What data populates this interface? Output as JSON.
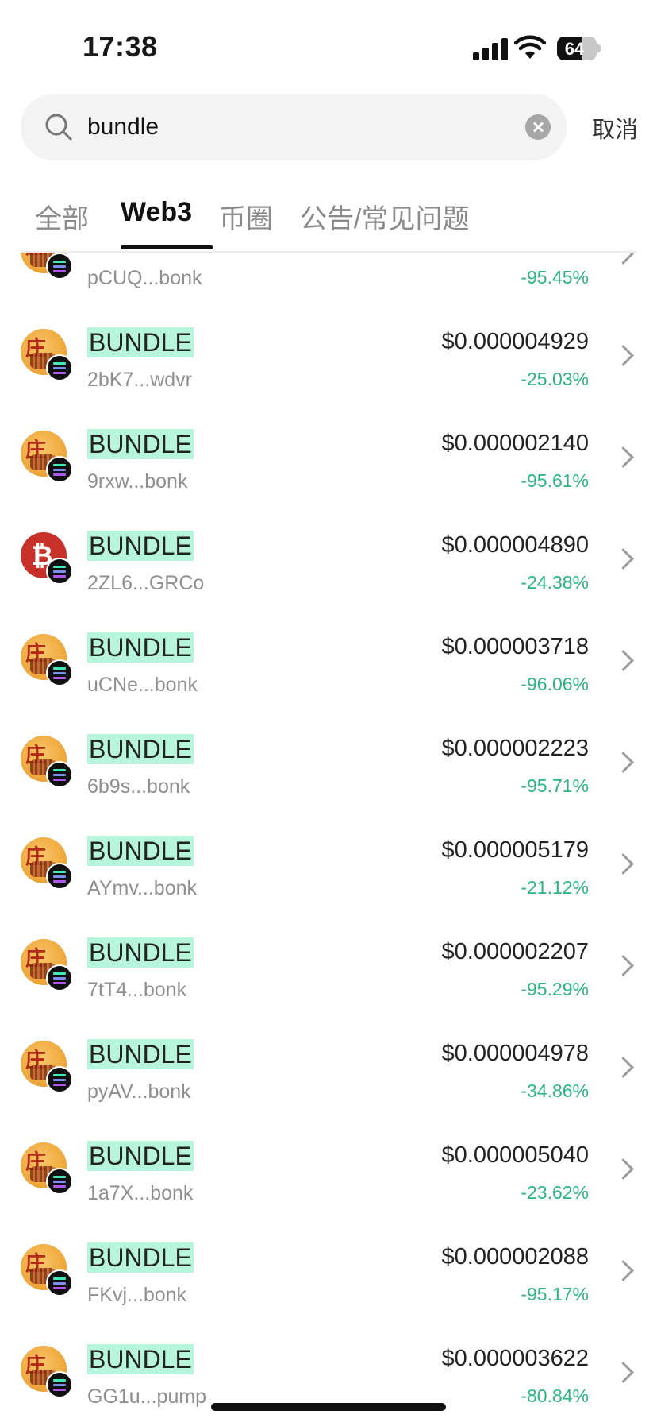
{
  "status_bar": {
    "time": "17:38",
    "battery": "64",
    "battery_level": 0.64
  },
  "search": {
    "value": "bundle",
    "cancel_label": "取消"
  },
  "tabs": [
    {
      "label": "全部"
    },
    {
      "label": "Web3"
    },
    {
      "label": "币圈"
    },
    {
      "label": "公告/常见问题"
    }
  ],
  "active_tab": "Web3",
  "colors": {
    "highlight": "#b7f5dc",
    "negative_change": "#2bb580",
    "accent": "#111111"
  },
  "results": [
    {
      "name": "",
      "address": "pCUQ...bonk",
      "price": "",
      "change": "-95.45%",
      "icon": "bundle-coin-icon",
      "chain_icon": "solana-icon"
    },
    {
      "name": "BUNDLE",
      "address": "2bK7...wdvr",
      "price": "$0.000004929",
      "change": "-25.03%",
      "icon": "bundle-coin-icon",
      "chain_icon": "solana-icon"
    },
    {
      "name": "BUNDLE",
      "address": "9rxw...bonk",
      "price": "$0.000002140",
      "change": "-95.61%",
      "icon": "bundle-coin-icon",
      "chain_icon": "solana-icon"
    },
    {
      "name": "BUNDLE",
      "address": "2ZL6...GRCo",
      "price": "$0.000004890",
      "change": "-24.38%",
      "icon": "red-b-coin-icon",
      "chain_icon": "solana-icon"
    },
    {
      "name": "BUNDLE",
      "address": "uCNe...bonk",
      "price": "$0.000003718",
      "change": "-96.06%",
      "icon": "bundle-coin-icon",
      "chain_icon": "solana-icon"
    },
    {
      "name": "BUNDLE",
      "address": "6b9s...bonk",
      "price": "$0.000002223",
      "change": "-95.71%",
      "icon": "bundle-coin-icon",
      "chain_icon": "solana-icon"
    },
    {
      "name": "BUNDLE",
      "address": "AYmv...bonk",
      "price": "$0.000005179",
      "change": "-21.12%",
      "icon": "bundle-coin-icon",
      "chain_icon": "solana-icon"
    },
    {
      "name": "BUNDLE",
      "address": "7tT4...bonk",
      "price": "$0.000002207",
      "change": "-95.29%",
      "icon": "bundle-coin-icon",
      "chain_icon": "solana-icon"
    },
    {
      "name": "BUNDLE",
      "address": "pyAV...bonk",
      "price": "$0.000004978",
      "change": "-34.86%",
      "icon": "bundle-coin-icon",
      "chain_icon": "solana-icon"
    },
    {
      "name": "BUNDLE",
      "address": "1a7X...bonk",
      "price": "$0.000005040",
      "change": "-23.62%",
      "icon": "bundle-coin-icon",
      "chain_icon": "solana-icon"
    },
    {
      "name": "BUNDLE",
      "address": "FKvj...bonk",
      "price": "$0.000002088",
      "change": "-95.17%",
      "icon": "bundle-coin-icon",
      "chain_icon": "solana-icon"
    },
    {
      "name": "BUNDLE",
      "address": "GG1u...pump",
      "price": "$0.000003622",
      "change": "-80.84%",
      "icon": "bundle-coin-icon",
      "chain_icon": "solana-icon"
    }
  ]
}
